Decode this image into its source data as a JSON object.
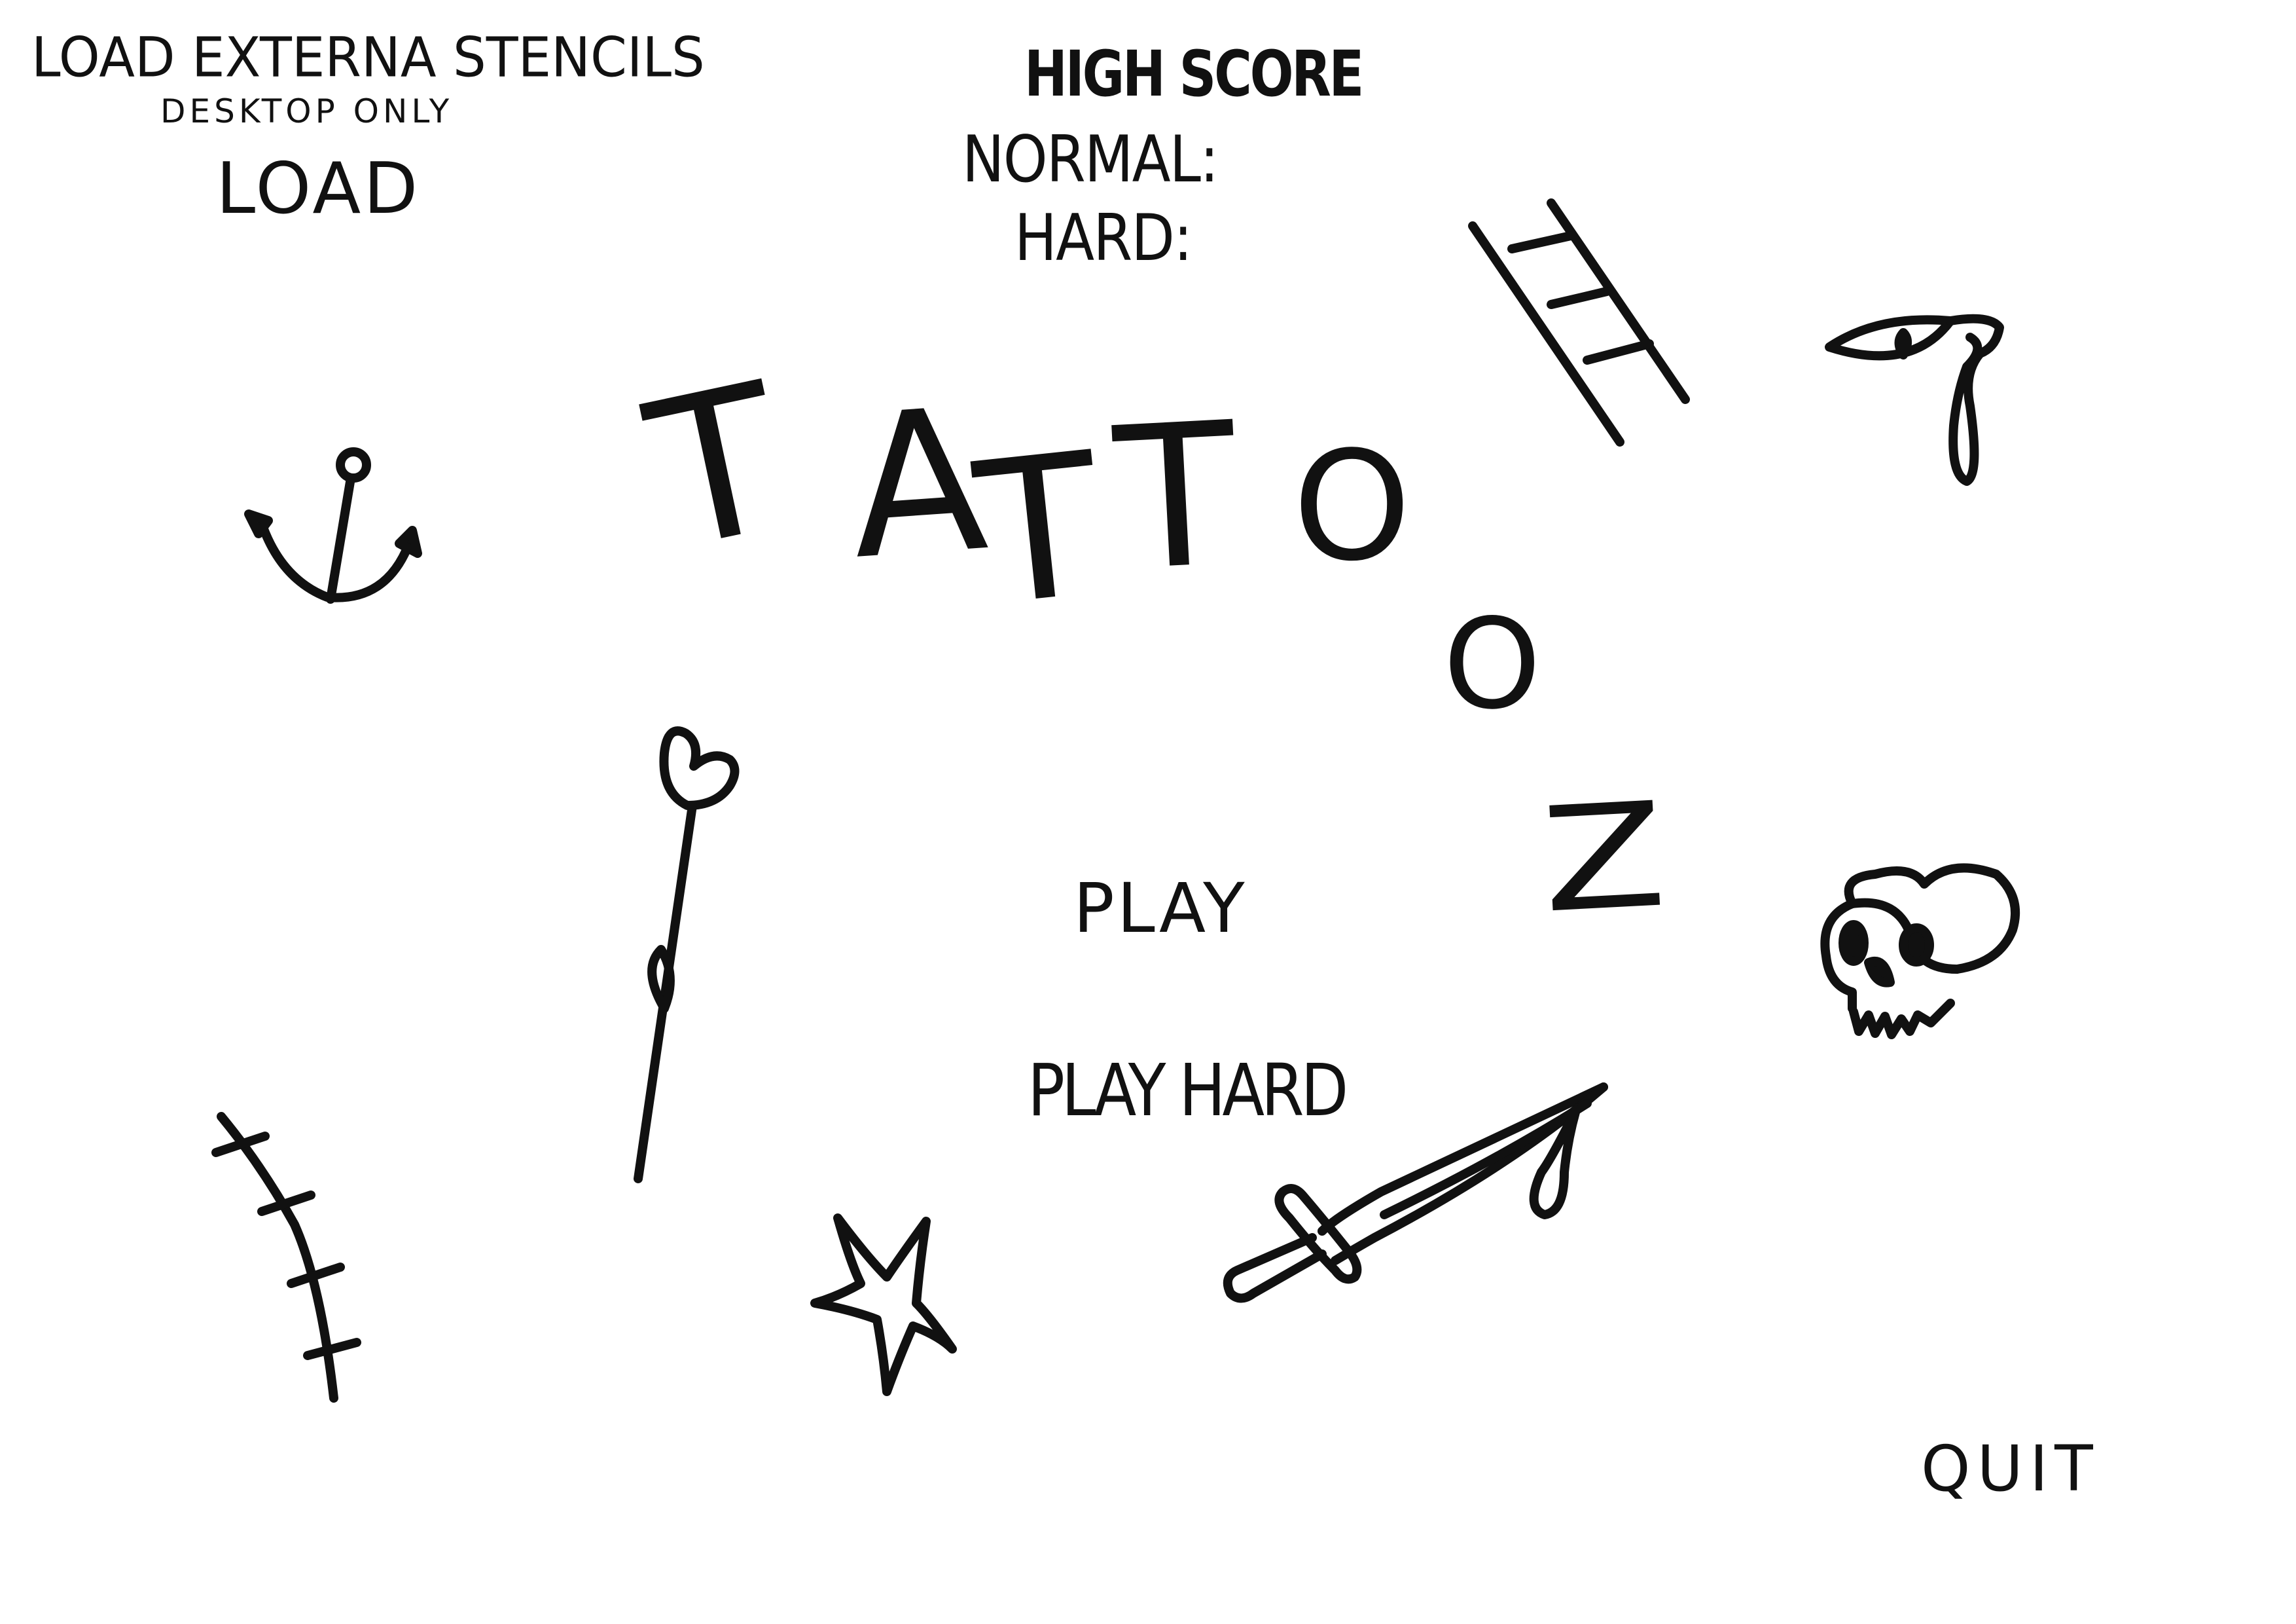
{
  "load_panel": {
    "heading": "LOAD EXTERNA STENCILS",
    "subheading": "DESKTOP ONLY",
    "load_label": "LOAD"
  },
  "high_score": {
    "heading": "HIGH SCORE",
    "normal_label": "NORMAL:",
    "hard_label": "HARD:"
  },
  "title": {
    "letters": [
      "T",
      "A",
      "T",
      "T",
      "O",
      "O",
      "Z"
    ]
  },
  "menu": {
    "play_label": "PLAY",
    "play_hard_label": "PLAY HARD",
    "quit_label": "QUIT"
  },
  "doodles": [
    "anchor-icon",
    "ladder-icon",
    "crying-eye-icon",
    "flower-icon",
    "skull-icon",
    "scar-stitches-icon",
    "star-icon",
    "dagger-icon"
  ],
  "colors": {
    "ink": "#111111",
    "paper": "#ffffff"
  }
}
